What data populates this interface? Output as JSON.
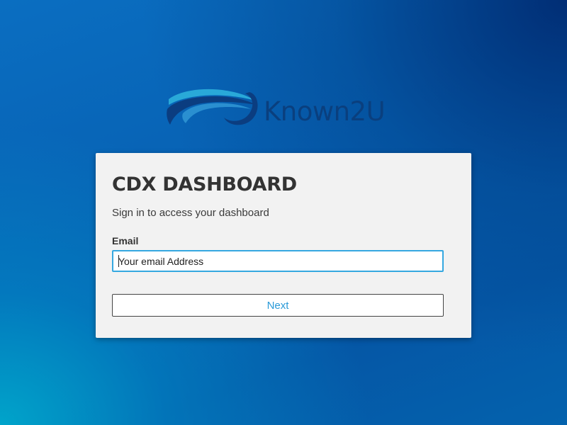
{
  "brand": {
    "name": "Known2U",
    "logo_icon": "wave-swoosh-icon",
    "colors": {
      "text": "#0a3f7e",
      "wave_light": "#29a9d8",
      "wave_dark": "#0b3d80"
    }
  },
  "login_card": {
    "title": "CDX DASHBOARD",
    "subtitle": "Sign in to access your dashboard",
    "email_label": "Email",
    "email_value": "",
    "email_placeholder": "Your email Address",
    "next_label": "Next"
  },
  "theme": {
    "accent": "#2a9ad8",
    "input_focus_border": "#35a8e0",
    "card_background": "#f2f2f2",
    "background_gradient": [
      "#00a8cc",
      "#0760b2",
      "#00286e"
    ]
  }
}
